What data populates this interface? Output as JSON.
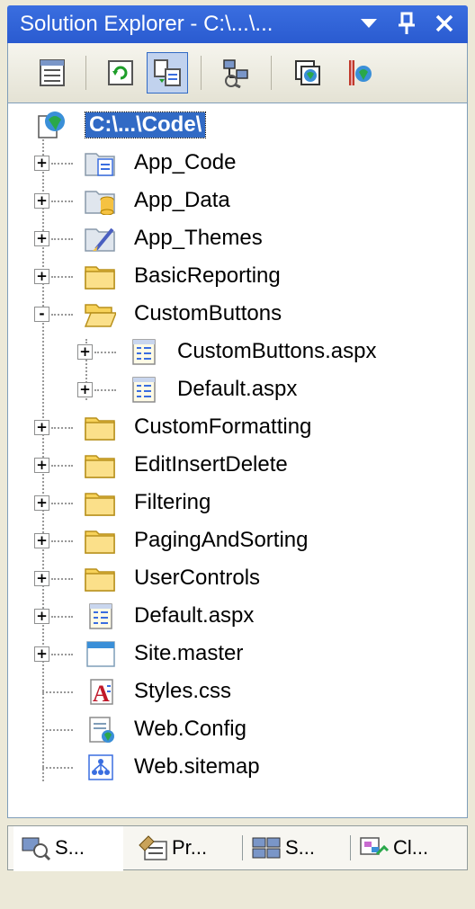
{
  "window": {
    "title": "Solution Explorer - C:\\...\\...",
    "dropdown_icon": "dropdown-arrow-icon",
    "pin_icon": "pin-icon",
    "close_icon": "close-icon"
  },
  "toolbar": {
    "buttons": [
      {
        "name": "properties-button",
        "icon": "properties-icon"
      },
      {
        "name": "refresh-button",
        "icon": "refresh-icon"
      },
      {
        "name": "nest-related-files-button",
        "icon": "nest-files-icon",
        "active": true
      },
      {
        "name": "copy-website-button",
        "icon": "copy-website-icon"
      },
      {
        "name": "view-in-browser-button",
        "icon": "view-in-browser-icon"
      },
      {
        "name": "asp-net-configuration-button",
        "icon": "asp-config-icon"
      }
    ]
  },
  "tree": {
    "root": {
      "label": "C:\\...\\Code\\",
      "icon": "website-icon",
      "selected": true
    },
    "items": [
      {
        "label": "App_Code",
        "icon": "special-folder-code-icon",
        "expander": "+",
        "level": 1
      },
      {
        "label": "App_Data",
        "icon": "special-folder-data-icon",
        "expander": "+",
        "level": 1
      },
      {
        "label": "App_Themes",
        "icon": "special-folder-themes-icon",
        "expander": "+",
        "level": 1
      },
      {
        "label": "BasicReporting",
        "icon": "folder-icon",
        "expander": "+",
        "level": 1
      },
      {
        "label": "CustomButtons",
        "icon": "folder-open-icon",
        "expander": "-",
        "level": 1
      },
      {
        "label": "CustomButtons.aspx",
        "icon": "aspx-file-icon",
        "expander": "+",
        "level": 2
      },
      {
        "label": "Default.aspx",
        "icon": "aspx-file-icon",
        "expander": "+",
        "level": 2
      },
      {
        "label": "CustomFormatting",
        "icon": "folder-icon",
        "expander": "+",
        "level": 1
      },
      {
        "label": "EditInsertDelete",
        "icon": "folder-icon",
        "expander": "+",
        "level": 1
      },
      {
        "label": "Filtering",
        "icon": "folder-icon",
        "expander": "+",
        "level": 1
      },
      {
        "label": "PagingAndSorting",
        "icon": "folder-icon",
        "expander": "+",
        "level": 1
      },
      {
        "label": "UserControls",
        "icon": "folder-icon",
        "expander": "+",
        "level": 1
      },
      {
        "label": "Default.aspx",
        "icon": "aspx-file-icon",
        "expander": "+",
        "level": 1
      },
      {
        "label": "Site.master",
        "icon": "master-page-icon",
        "expander": "+",
        "level": 1
      },
      {
        "label": "Styles.css",
        "icon": "css-file-icon",
        "expander": "",
        "level": 1
      },
      {
        "label": "Web.Config",
        "icon": "config-file-icon",
        "expander": "",
        "level": 1
      },
      {
        "label": "Web.sitemap",
        "icon": "sitemap-file-icon",
        "expander": "",
        "level": 1
      }
    ]
  },
  "tabs": [
    {
      "label": "S...",
      "icon": "solution-explorer-icon",
      "active": true
    },
    {
      "label": "Pr...",
      "icon": "properties-window-icon"
    },
    {
      "label": "S...",
      "icon": "server-explorer-icon"
    },
    {
      "label": "Cl...",
      "icon": "class-view-icon"
    }
  ]
}
